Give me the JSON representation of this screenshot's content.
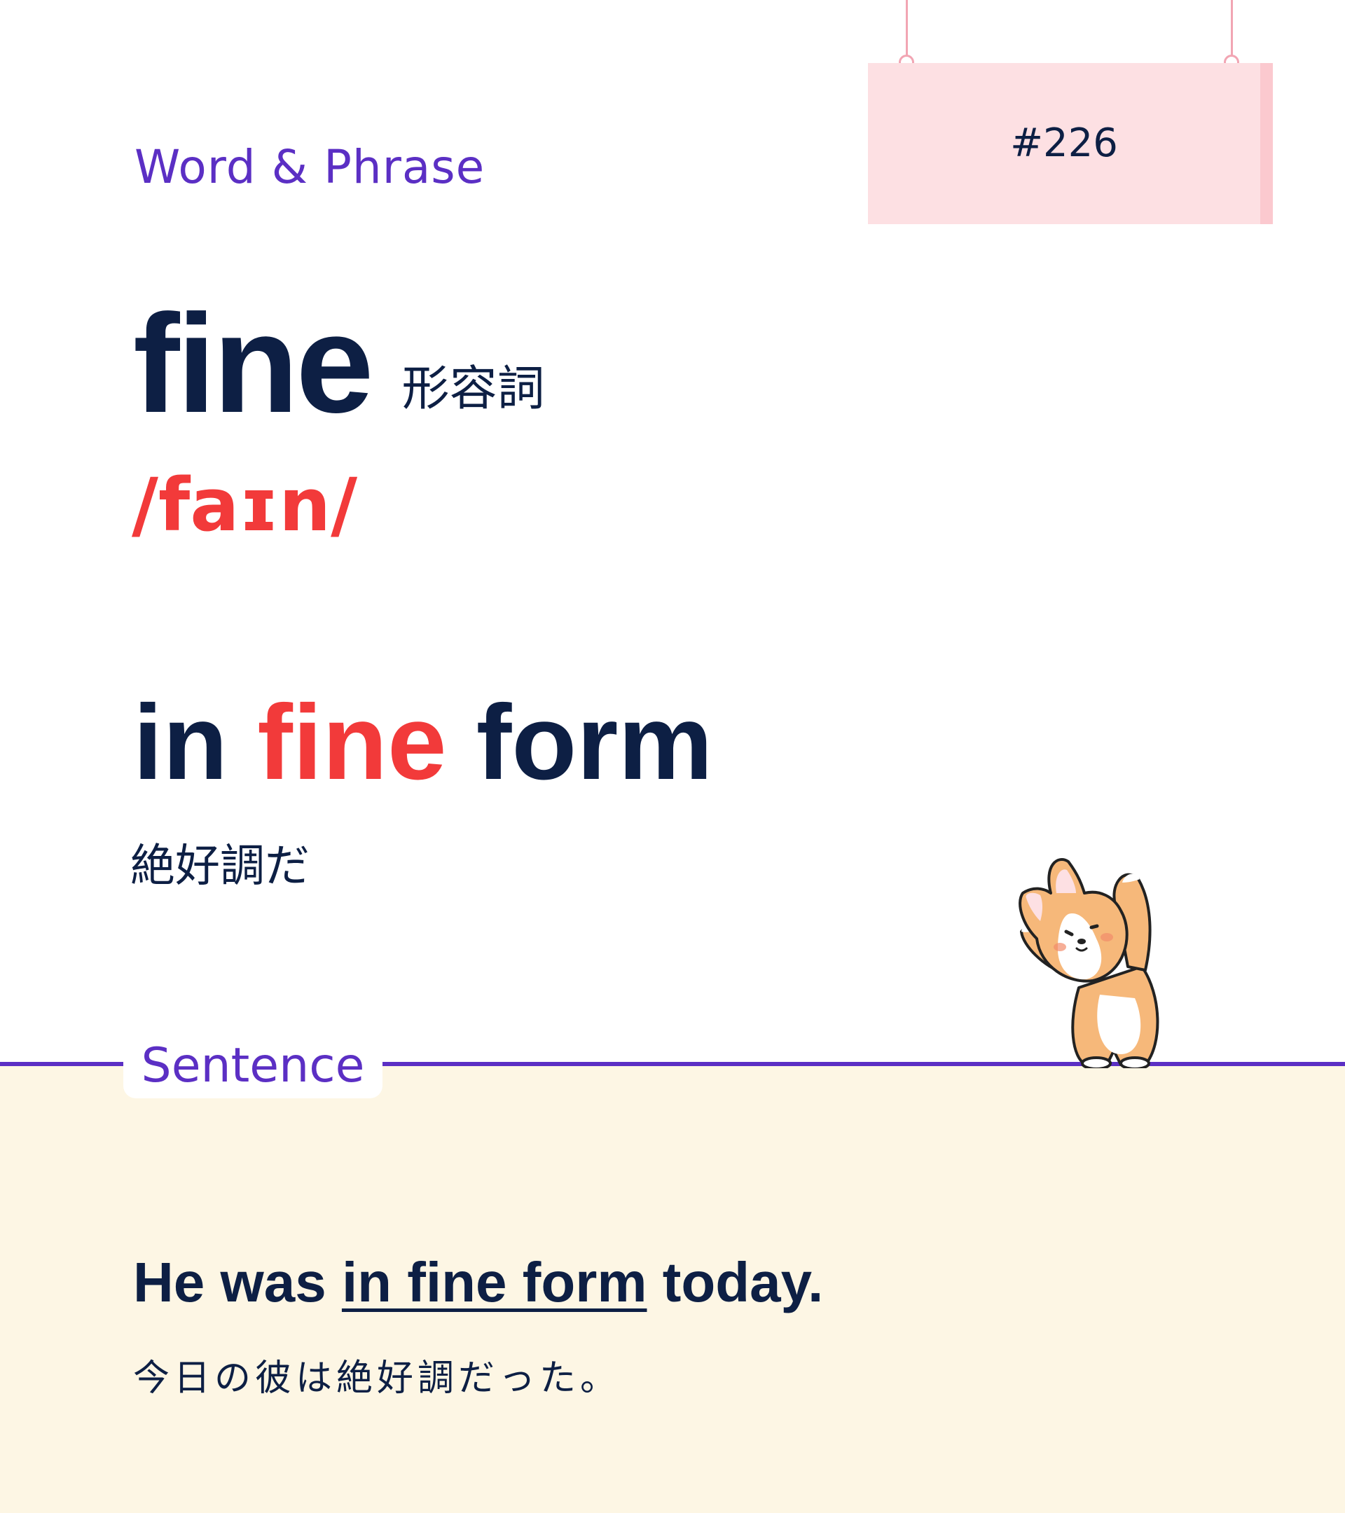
{
  "card": {
    "category": "Word & Phrase",
    "number": "#226"
  },
  "word": {
    "headword": "fine",
    "part_of_speech": "形容詞",
    "pronunciation": "/faɪn/"
  },
  "phrase": {
    "before": "in ",
    "highlight": "fine",
    "after": " form",
    "translation": "絶好調だ"
  },
  "section": {
    "label": "Sentence"
  },
  "example": {
    "before": "He was ",
    "underlined": "in fine form",
    "after": " today.",
    "translation": "今日の彼は絶好調だった。"
  },
  "colors": {
    "accent_purple": "#5b2fc4",
    "highlight_red": "#f23a3a",
    "text_navy": "#0d1f44",
    "sign_pink": "#fde0e3",
    "sentence_bg": "#fdf6e4"
  },
  "icons": {
    "mascot": "corgi-stretching-illustration"
  }
}
